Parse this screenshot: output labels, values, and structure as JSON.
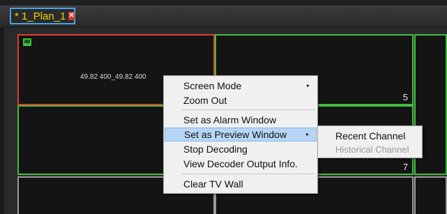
{
  "tabs": [
    {
      "label": "* 1_Plan_1",
      "close_icon": "close-icon",
      "active": true
    }
  ],
  "wall": {
    "cells": [
      {
        "ip": "49.82 400_49.82 400",
        "camera_icon": "camera-icon",
        "number": ""
      },
      {
        "number": "5"
      },
      {
        "number": ""
      },
      {
        "number": "7"
      },
      {
        "number": ""
      },
      {
        "number": ""
      },
      {
        "number": ""
      },
      {
        "number": ""
      }
    ]
  },
  "context_menu": {
    "items": [
      {
        "label": "Screen Mode",
        "has_submenu": true
      },
      {
        "label": "Zoom Out",
        "has_submenu": false
      },
      {
        "label": "Set as Alarm Window",
        "has_submenu": false
      },
      {
        "label": "Set as Preview Window",
        "has_submenu": true,
        "highlighted": true
      },
      {
        "label": "Stop Decoding",
        "has_submenu": false
      },
      {
        "label": "View Decoder Output Info.",
        "has_submenu": false
      },
      {
        "label": "Clear TV Wall",
        "has_submenu": false
      }
    ],
    "arrow_glyph": "▸"
  },
  "submenu": {
    "items": [
      {
        "label": "Recent Channel",
        "enabled": true
      },
      {
        "label": "Historical Channel",
        "enabled": false
      }
    ]
  },
  "colors": {
    "active_cell_border": "#e04030",
    "cell_border": "#3fbf3f",
    "tab_label": "#f0d400",
    "tab_border": "#4aa3e6",
    "menu_highlight": "#b7d6f5"
  }
}
